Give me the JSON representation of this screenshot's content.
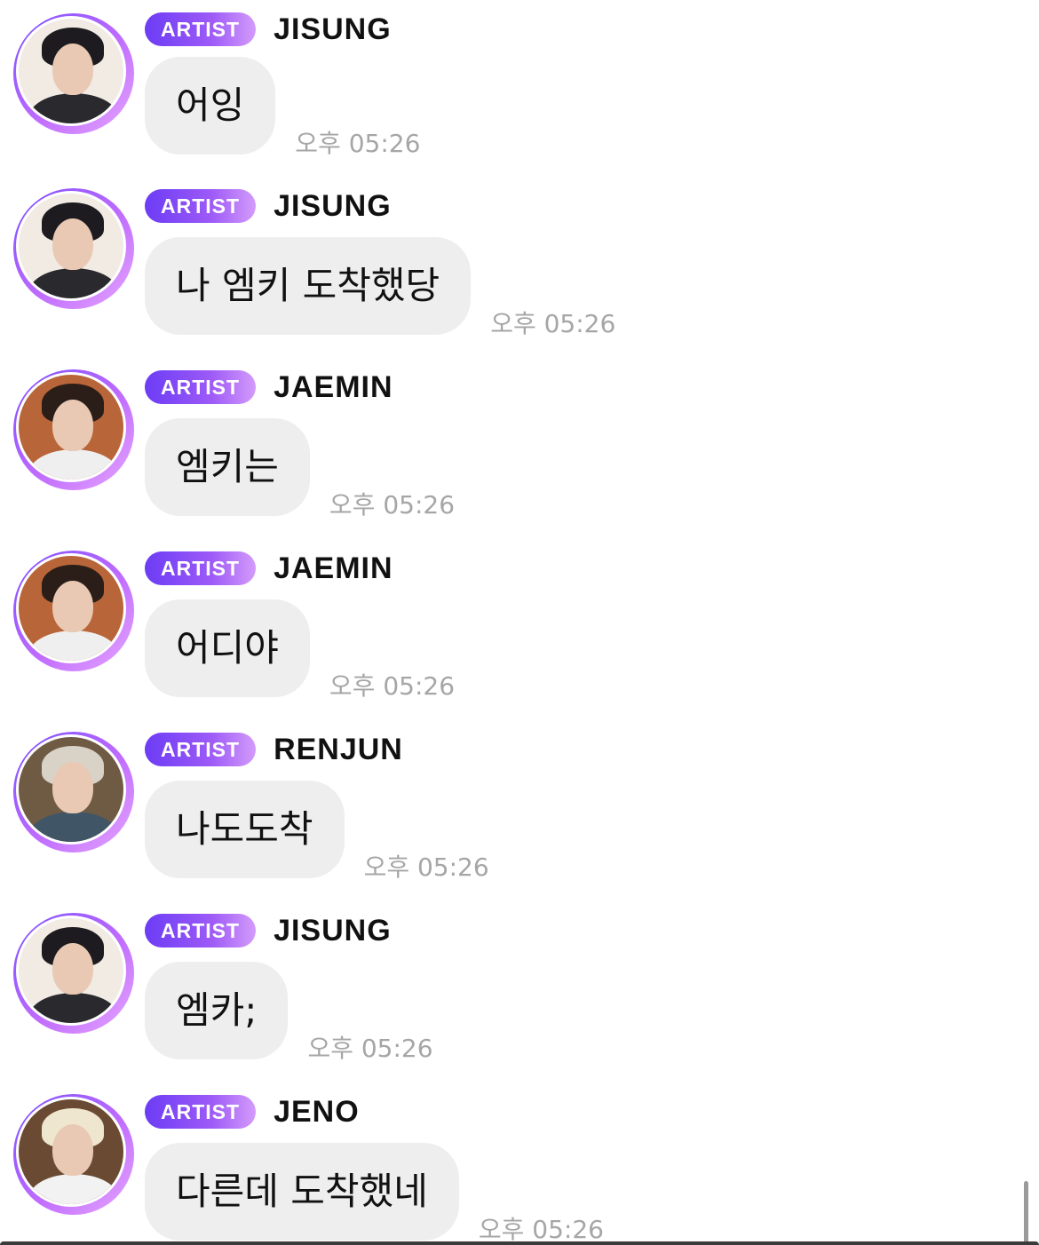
{
  "messages": [
    {
      "badge": "ARTIST",
      "sender": "JISUNG",
      "text": "어잉",
      "time": "오후 05:26",
      "avatar": "jisung"
    },
    {
      "badge": "ARTIST",
      "sender": "JISUNG",
      "text": "나 엠키 도착했당",
      "time": "오후 05:26",
      "avatar": "jisung"
    },
    {
      "badge": "ARTIST",
      "sender": "JAEMIN",
      "text": "엠키는",
      "time": "오후 05:26",
      "avatar": "jaemin"
    },
    {
      "badge": "ARTIST",
      "sender": "JAEMIN",
      "text": "어디야",
      "time": "오후 05:26",
      "avatar": "jaemin"
    },
    {
      "badge": "ARTIST",
      "sender": "RENJUN",
      "text": "나도도착",
      "time": "오후 05:26",
      "avatar": "renjun"
    },
    {
      "badge": "ARTIST",
      "sender": "JISUNG",
      "text": "엠카;",
      "time": "오후 05:26",
      "avatar": "jisung"
    },
    {
      "badge": "ARTIST",
      "sender": "JENO",
      "text": "다른데 도착했네",
      "time": "오후 05:26",
      "avatar": "jeno"
    }
  ],
  "colors": {
    "badge_gradient_start": "#6c3cf5",
    "badge_gradient_end": "#d49bfb",
    "bubble": "#eeeeee",
    "timestamp": "#a6a6a6"
  }
}
